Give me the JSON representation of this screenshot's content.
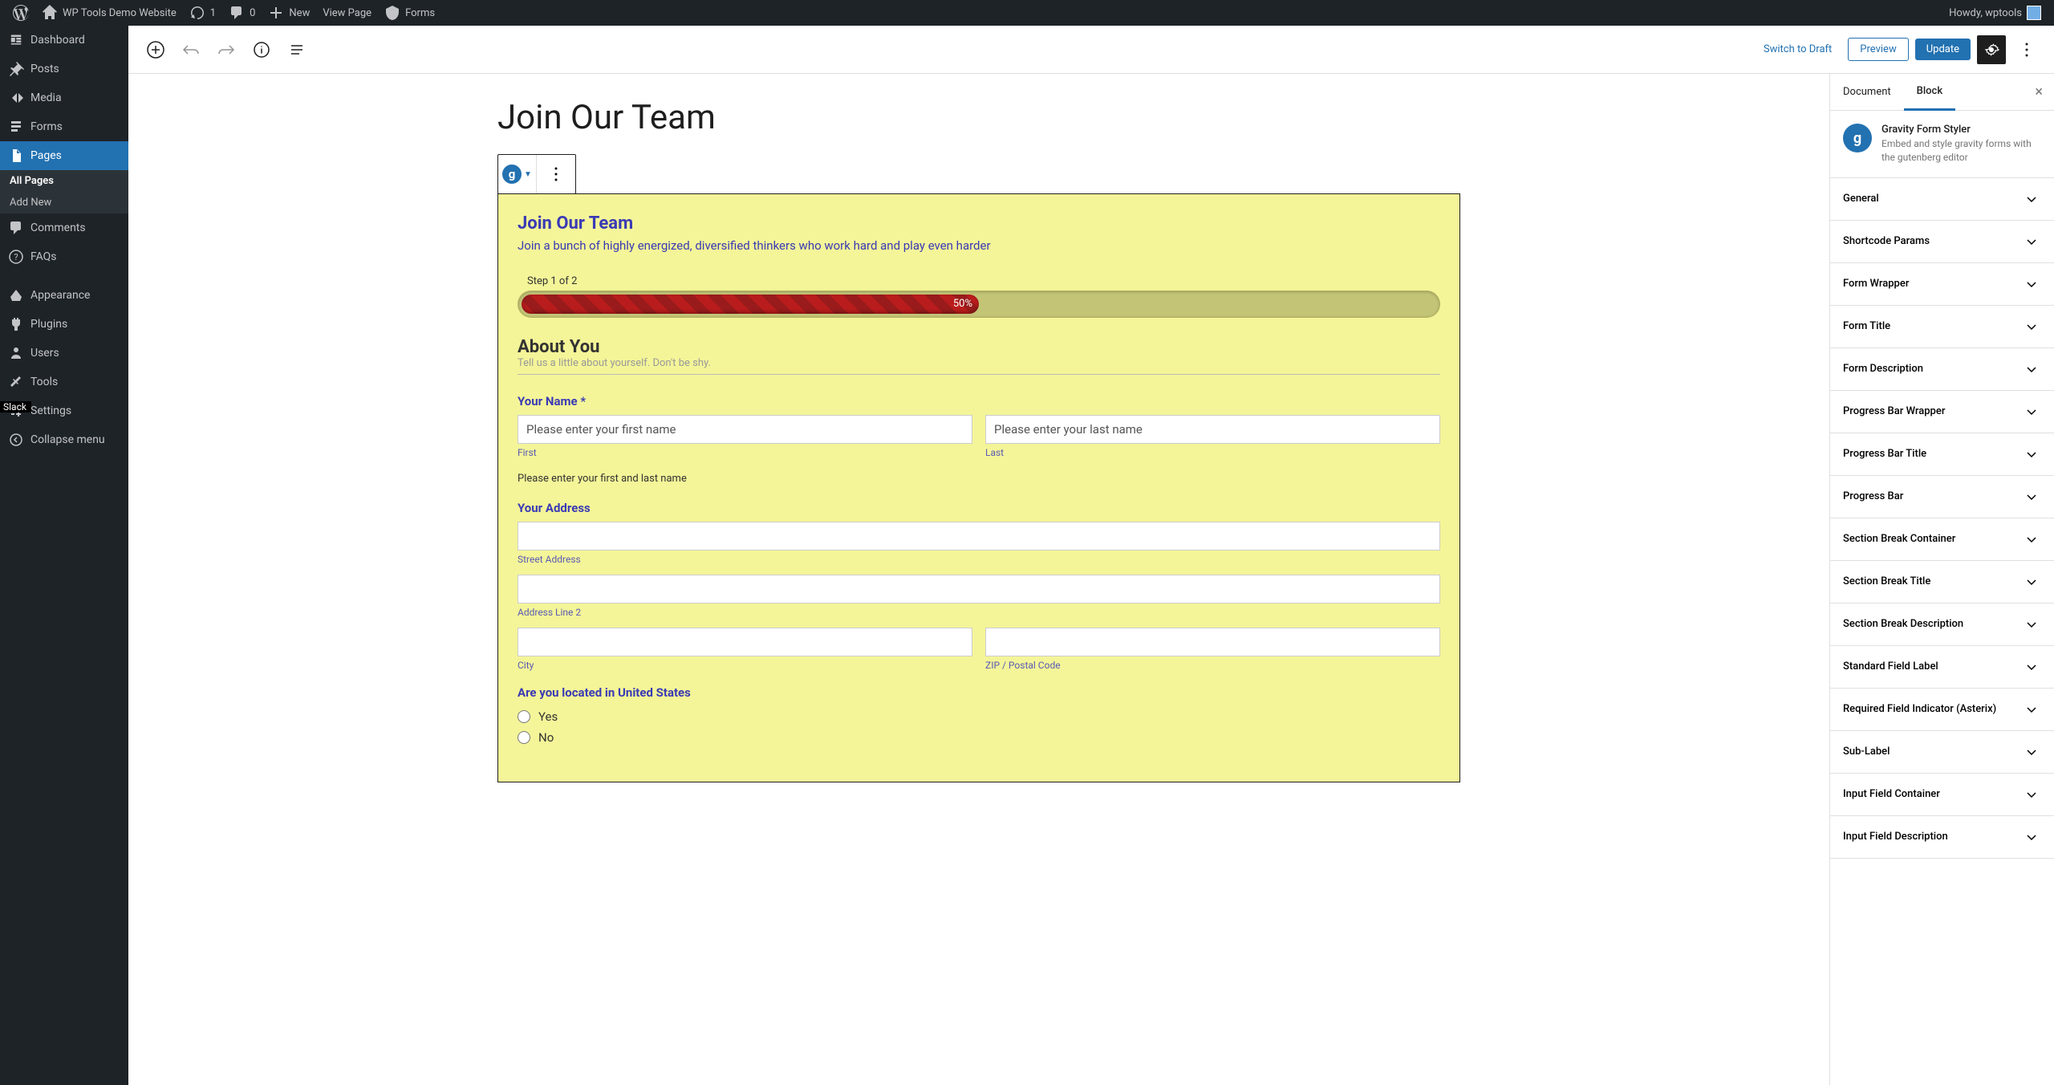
{
  "adminBar": {
    "siteName": "WP Tools Demo Website",
    "revisions": "1",
    "comments": "0",
    "newLabel": "New",
    "viewPage": "View Page",
    "forms": "Forms",
    "howdy": "Howdy, wptools"
  },
  "sidebar": {
    "items": [
      {
        "label": "Dashboard",
        "icon": "dashboard"
      },
      {
        "label": "Posts",
        "icon": "pin"
      },
      {
        "label": "Media",
        "icon": "media"
      },
      {
        "label": "Forms",
        "icon": "forms"
      },
      {
        "label": "Pages",
        "icon": "pages",
        "active": true
      },
      {
        "label": "Comments",
        "icon": "comments"
      },
      {
        "label": "FAQs",
        "icon": "help"
      },
      {
        "label": "Appearance",
        "icon": "appearance"
      },
      {
        "label": "Plugins",
        "icon": "plugins"
      },
      {
        "label": "Users",
        "icon": "users"
      },
      {
        "label": "Tools",
        "icon": "tools"
      },
      {
        "label": "Settings",
        "icon": "settings"
      }
    ],
    "sub": {
      "allPages": "All Pages",
      "addNew": "Add New"
    },
    "collapse": "Collapse menu",
    "slack": "Slack"
  },
  "editorHeader": {
    "switchDraft": "Switch to Draft",
    "preview": "Preview",
    "update": "Update"
  },
  "page": {
    "title": "Join Our Team"
  },
  "form": {
    "title": "Join Our Team",
    "description": "Join a bunch of highly energized, diversified thinkers who work hard and play even harder",
    "stepLabel": "Step 1 of 2",
    "progressPct": "50%",
    "section": {
      "title": "About You",
      "desc": "Tell us a little about yourself. Don't be shy."
    },
    "nameField": {
      "label": "Your Name",
      "required": "*",
      "firstPlaceholder": "Please enter your first name",
      "lastPlaceholder": "Please enter your last name",
      "firstSub": "First",
      "lastSub": "Last",
      "help": "Please enter your first and last name"
    },
    "addressField": {
      "label": "Your Address",
      "street": "Street Address",
      "line2": "Address Line 2",
      "city": "City",
      "zip": "ZIP / Postal Code"
    },
    "usField": {
      "label": "Are you located in United States",
      "yes": "Yes",
      "no": "No"
    }
  },
  "settings": {
    "tabs": {
      "document": "Document",
      "block": "Block"
    },
    "block": {
      "name": "Gravity Form Styler",
      "desc": "Embed and style gravity forms with the gutenberg editor"
    },
    "panels": [
      "General",
      "Shortcode Params",
      "Form Wrapper",
      "Form Title",
      "Form Description",
      "Progress Bar Wrapper",
      "Progress Bar Title",
      "Progress Bar",
      "Section Break Container",
      "Section Break Title",
      "Section Break Description",
      "Standard Field Label",
      "Required Field Indicator (Asterix)",
      "Sub-Label",
      "Input Field Container",
      "Input Field Description"
    ]
  }
}
